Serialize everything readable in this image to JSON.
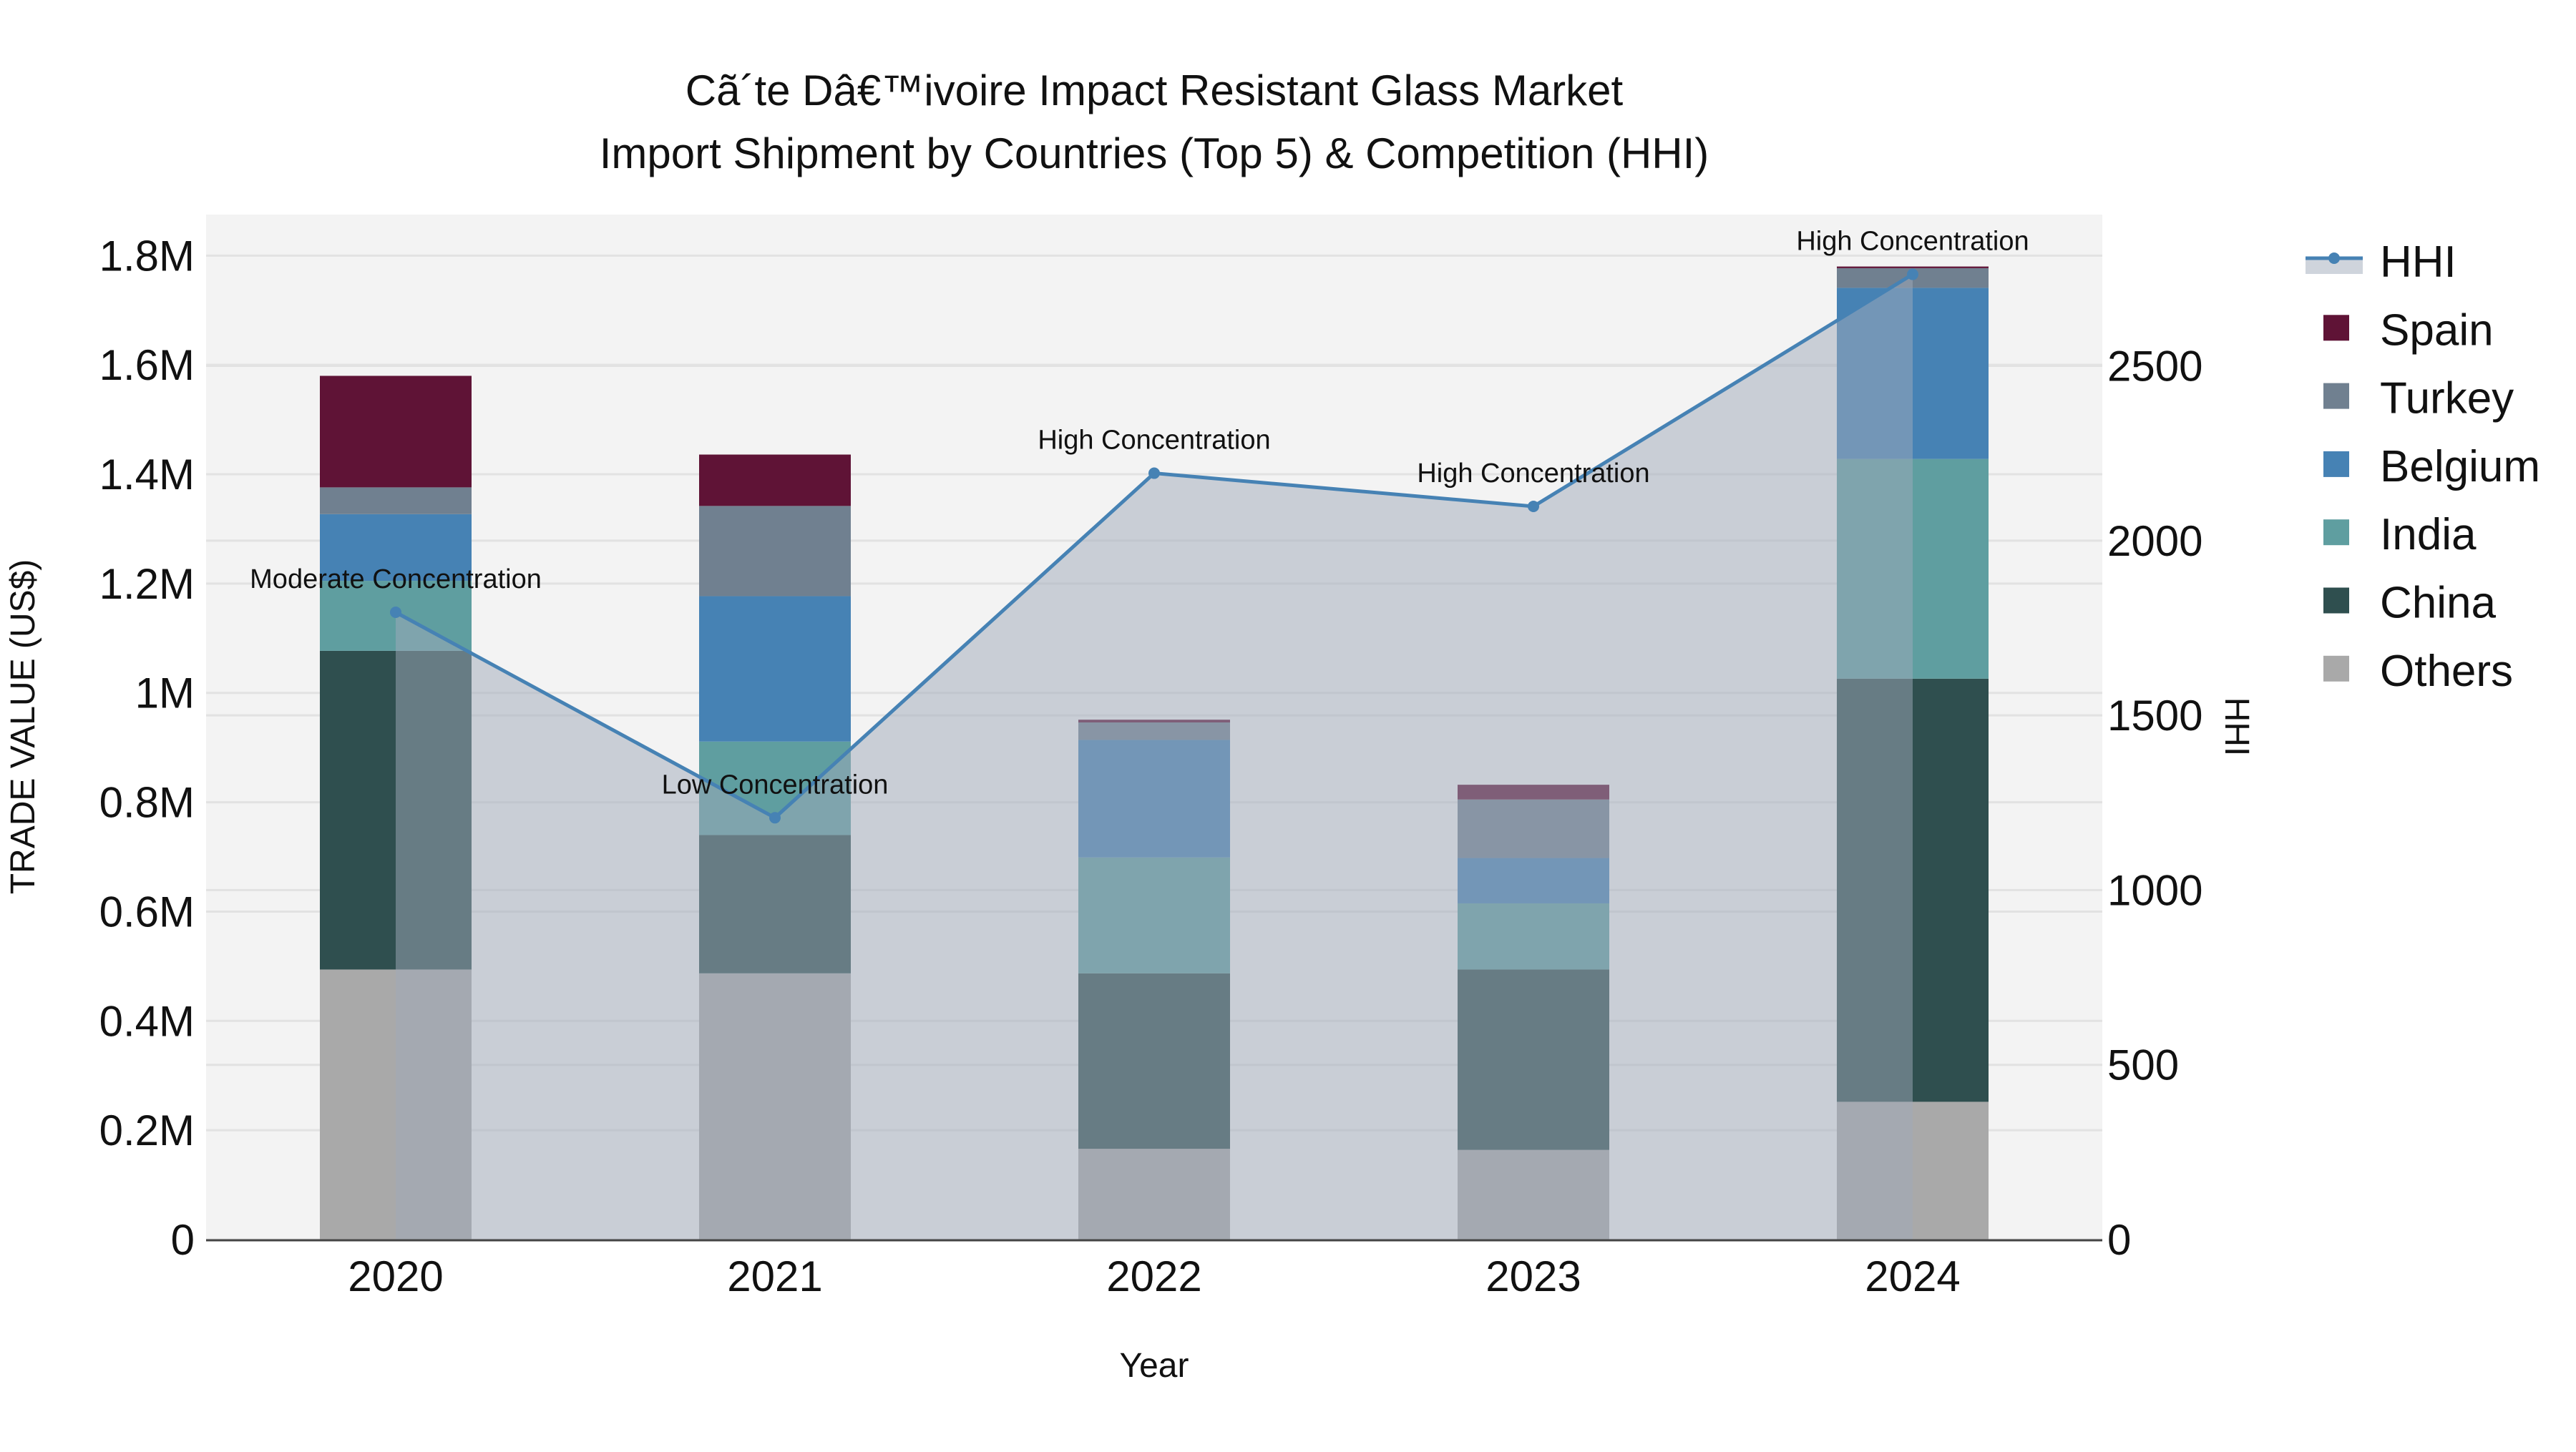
{
  "chart_data": {
    "type": "bar",
    "stacked": true,
    "title": "Cã´te Dâ€™ivoire Impact Resistant Glass Market",
    "subtitle": "Import Shipment by Countries (Top 5) & Competition (HHI)",
    "xlabel": "Year",
    "ylabel": "TRADE VALUE (US$)",
    "y2label": "HHI",
    "categories": [
      "2020",
      "2021",
      "2022",
      "2023",
      "2024"
    ],
    "ylim": [
      0,
      1875000
    ],
    "y2lim": [
      0,
      2933
    ],
    "yticks": [
      0,
      200000,
      400000,
      600000,
      800000,
      1000000,
      1200000,
      1400000,
      1600000,
      1800000
    ],
    "ytick_labels": [
      "0",
      "0.2M",
      "0.4M",
      "0.6M",
      "0.8M",
      "1M",
      "1.2M",
      "1.4M",
      "1.6M",
      "1.8M"
    ],
    "y2ticks": [
      0,
      500,
      1000,
      1500,
      2000,
      2500
    ],
    "y2tick_labels": [
      "0",
      "500",
      "1000",
      "1500",
      "2000",
      "2500"
    ],
    "grid": true,
    "legend_position": "right",
    "series": [
      {
        "name": "Others",
        "color": "#a9a9a9",
        "values": [
          494000,
          487000,
          166000,
          164000,
          252000
        ]
      },
      {
        "name": "China",
        "color": "#2f4f4f",
        "values": [
          583000,
          253000,
          321000,
          330000,
          774000
        ]
      },
      {
        "name": "India",
        "color": "#5f9ea0",
        "values": [
          128000,
          171000,
          212000,
          121000,
          402000
        ]
      },
      {
        "name": "Belgium",
        "color": "#4682b4",
        "values": [
          122000,
          266000,
          215000,
          83000,
          313000
        ]
      },
      {
        "name": "Turkey",
        "color": "#708090",
        "values": [
          49000,
          165000,
          32000,
          107000,
          36000
        ]
      },
      {
        "name": "Spain",
        "color": "#5f1336",
        "values": [
          204000,
          94000,
          5000,
          27000,
          3000
        ]
      }
    ],
    "line": {
      "name": "HHI",
      "color": "#4682b4",
      "axis": "y2",
      "values": [
        1795,
        1207,
        2193,
        2098,
        2762
      ],
      "annotations": [
        "Moderate Concentration",
        "Low Concentration",
        "High Concentration",
        "High Concentration",
        "High Concentration"
      ]
    },
    "legend": [
      "HHI",
      "Spain",
      "Turkey",
      "Belgium",
      "India",
      "China",
      "Others"
    ]
  }
}
